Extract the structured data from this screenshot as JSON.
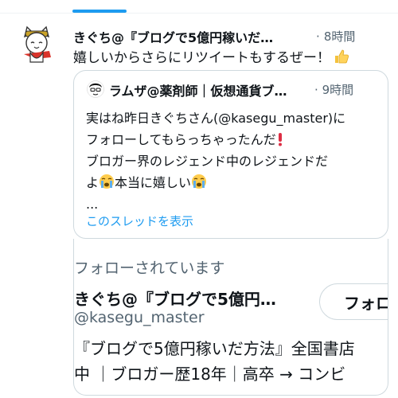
{
  "tweet": {
    "author_name": "きぐち@『ブログで5億円稼いだ…",
    "separator": "·",
    "time": "8時間",
    "text": "嬉しいからさらにリツイートもするぜー！",
    "emoji": "thumbs-up"
  },
  "quote": {
    "author_name": "ラムザ@薬剤師｜仮想通貨ブ…",
    "separator": "·",
    "time": "9時間",
    "lines": [
      "実はね昨日きぐちさん(@kasegu_master)に",
      "フォローしてもらっちゃったんだ",
      "ブロガー界のレジェンド中のレジェンドだ",
      "よ",
      "本当に嬉しい",
      "..."
    ],
    "show_thread": "このスレッドを表示",
    "emojis": {
      "exclamation": "red-exclamation",
      "cry": "loudly-crying-face"
    }
  },
  "follow_card": {
    "heading": "フォローされています",
    "name": "きぐち@『ブログで5億円…",
    "handle": "@kasegu_master",
    "bio_lines": [
      "『ブログで5億円稼いだ方法』全国書店",
      "中 ｜ブロガー歴18年｜高卒 → コンビ"
    ],
    "follow_button": "フォロ"
  },
  "colors": {
    "accent": "#1d9bf0",
    "text": "#0f1419",
    "muted": "#536471",
    "border": "#cfd9de"
  }
}
